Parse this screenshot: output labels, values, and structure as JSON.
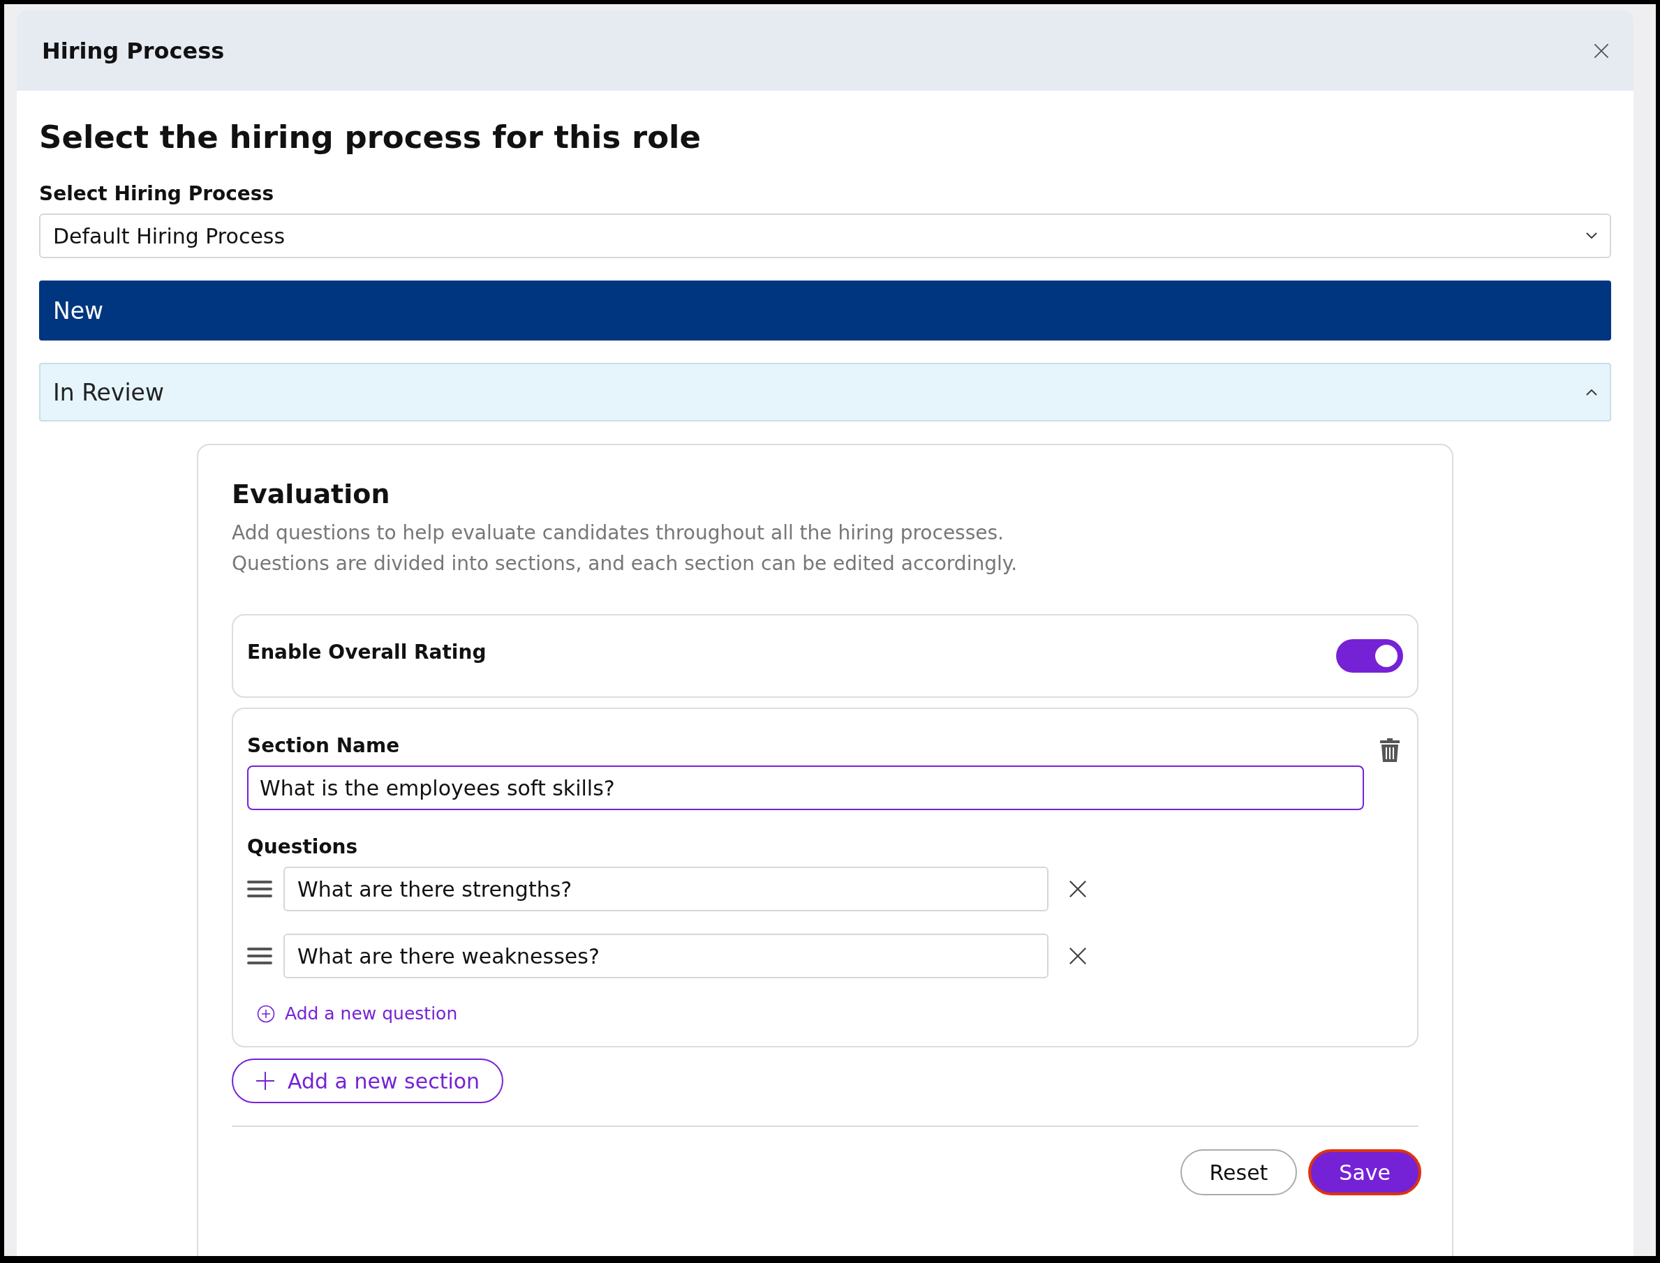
{
  "dialog": {
    "title": "Hiring Process"
  },
  "heading": "Select the hiring process for this role",
  "process_select": {
    "label": "Select Hiring Process",
    "value": "Default Hiring Process"
  },
  "stages": [
    {
      "label": "New",
      "selected": true,
      "expanded": false
    },
    {
      "label": "In Review",
      "selected": false,
      "expanded": true
    }
  ],
  "evaluation": {
    "title": "Evaluation",
    "description": [
      "Add questions to help evaluate candidates throughout all the hiring processes.",
      "Questions are divided into sections, and each section can be edited accordingly."
    ],
    "overall_rating": {
      "label": "Enable Overall Rating",
      "on": true
    },
    "sections": [
      {
        "name_label": "Section Name",
        "name": "What is the employees soft skills?",
        "focused": true,
        "questions_label": "Questions",
        "questions": [
          "What are there strengths?",
          "What are there weaknesses?"
        ],
        "add_question": "Add a new question"
      }
    ],
    "add_section": "Add a new section",
    "buttons": [
      {
        "label": "Reset",
        "kind": "secondary"
      },
      {
        "label": "Save",
        "kind": "primary"
      }
    ]
  }
}
